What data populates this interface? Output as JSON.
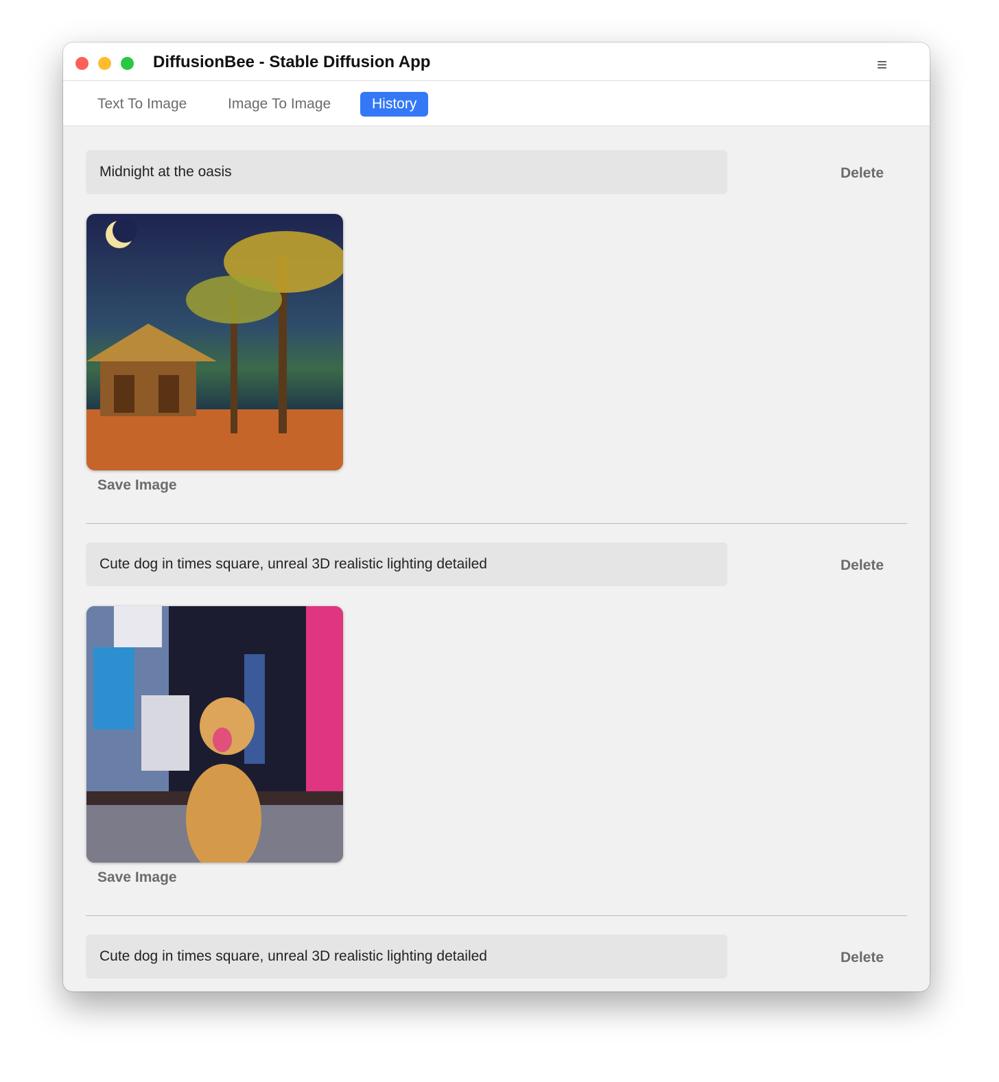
{
  "window": {
    "title": "DiffusionBee - Stable Diffusion App",
    "menu_icon": "hamburger-icon"
  },
  "tabs": [
    {
      "label": "Text To Image",
      "active": false
    },
    {
      "label": "Image To Image",
      "active": false
    },
    {
      "label": "History",
      "active": true
    }
  ],
  "history": [
    {
      "prompt": "Midnight at the oasis",
      "delete_label": "Delete",
      "save_label": "Save Image",
      "image": "palm-hut-night-painting"
    },
    {
      "prompt": "Cute dog in times square, unreal 3D realistic lighting detailed",
      "delete_label": "Delete",
      "save_label": "Save Image",
      "image": "dog-times-square"
    },
    {
      "prompt": "Cute dog in times square, unreal 3D realistic lighting detailed",
      "delete_label": "Delete"
    }
  ],
  "colors": {
    "accent": "#3478f6",
    "close": "#fe5f57",
    "minimize": "#febc2e",
    "zoom": "#28c840"
  }
}
